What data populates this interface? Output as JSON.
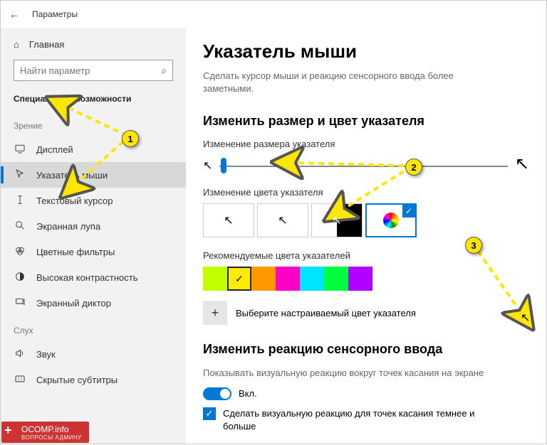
{
  "header": {
    "title": "Параметры"
  },
  "sidebar": {
    "home": "Главная",
    "search_placeholder": "Найти параметр",
    "section": "Специальные возможности",
    "groups": [
      {
        "title": "Зрение",
        "items": [
          {
            "label": "Дисплей"
          },
          {
            "label": "Указатель мыши"
          },
          {
            "label": "Текстовый курсор"
          },
          {
            "label": "Экранная лупа"
          },
          {
            "label": "Цветные фильтры"
          },
          {
            "label": "Высокая контрастность"
          },
          {
            "label": "Экранный диктор"
          }
        ]
      },
      {
        "title": "Слух",
        "items": [
          {
            "label": "Звук"
          },
          {
            "label": "Скрытые субтитры"
          }
        ]
      }
    ]
  },
  "main": {
    "title": "Указатель мыши",
    "desc": "Сделать курсор мыши и реакцию сенсорного ввода более заметными.",
    "section1": "Изменить размер и цвет указателя",
    "size_label": "Изменение размера указателя",
    "color_label": "Изменение цвета указателя",
    "rec_label": "Рекомендуемые цвета указателей",
    "custom_label": "Выберите настраиваемый цвет указателя",
    "section2": "Изменить реакцию сенсорного ввода",
    "touch_desc": "Показывать визуальную реакцию вокруг точек касания на экране",
    "toggle_on": "Вкл.",
    "check_label": "Сделать визуальную реакцию для точек касания темнее и больше",
    "palette": [
      "#c2ff00",
      "#ffeb00",
      "#ff9900",
      "#ff00c8",
      "#00e5ff",
      "#00ff3c",
      "#b300ff"
    ],
    "selected_palette": 1,
    "selected_color_option": 3
  },
  "watermark": {
    "top": "OCOMP.info",
    "bottom": "ВОПРОСЫ АДМИНУ"
  },
  "annotations": {
    "b1": "1",
    "b2": "2",
    "b3": "3"
  }
}
